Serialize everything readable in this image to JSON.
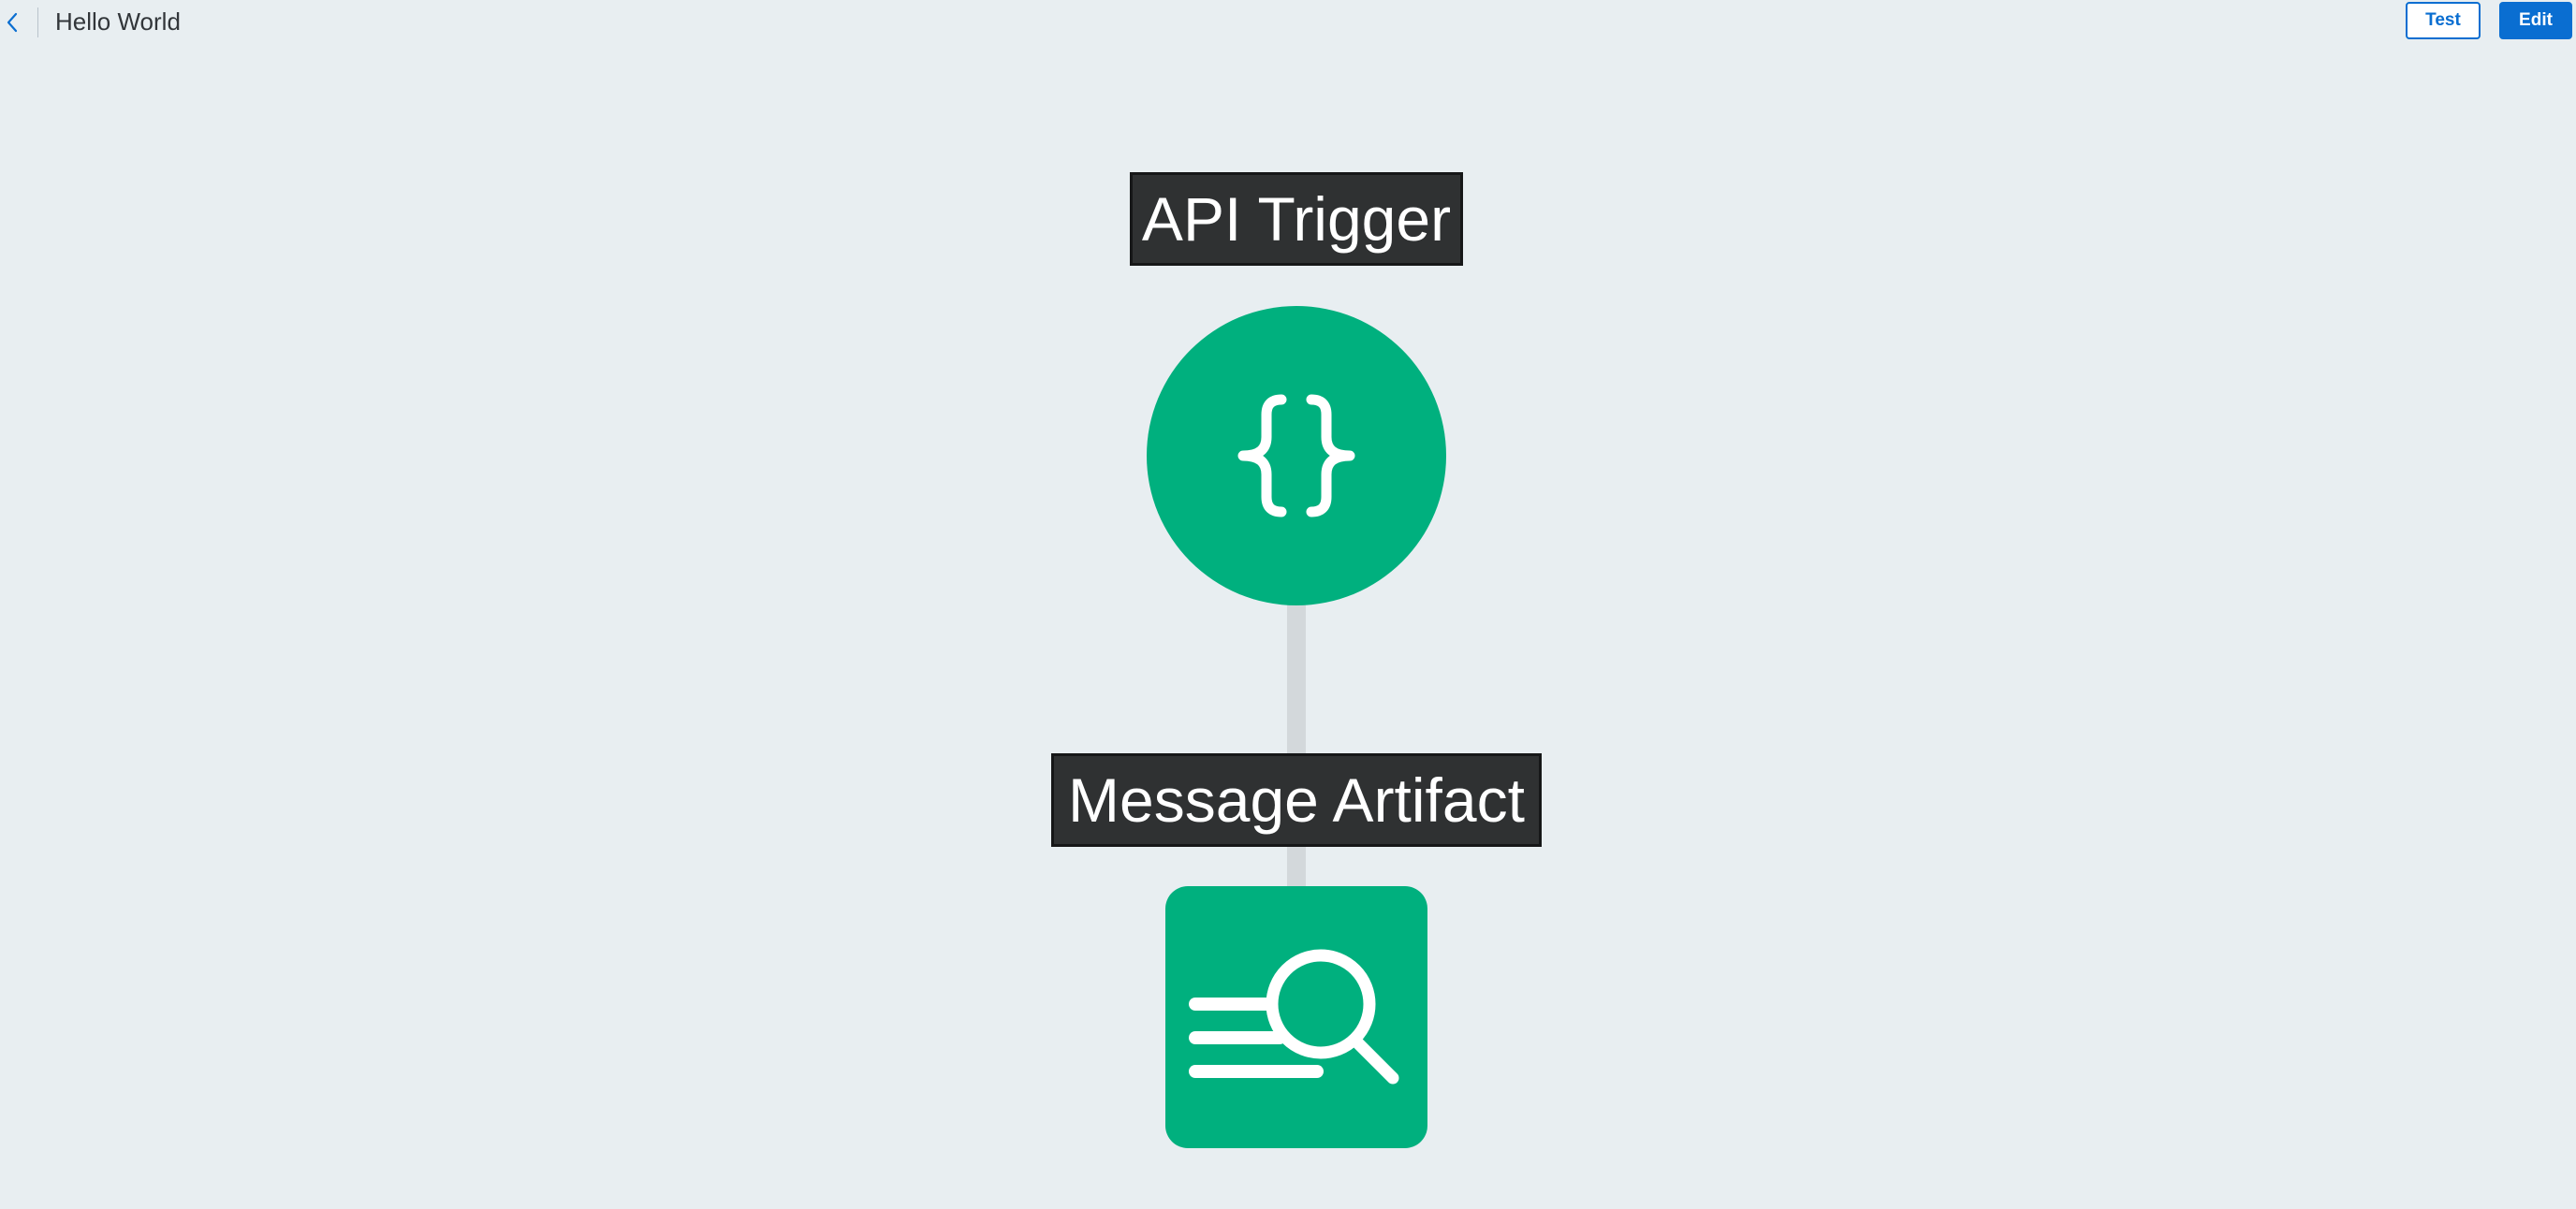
{
  "header": {
    "back_icon": "chevron-left-icon",
    "title": "Hello World",
    "test_label": "Test",
    "edit_label": "Edit"
  },
  "flow": {
    "nodes": [
      {
        "label": "API Trigger",
        "icon": "curly-braces-icon",
        "shape": "circle"
      },
      {
        "label": "Message Artifact",
        "icon": "text-search-icon",
        "shape": "rounded-square"
      }
    ]
  },
  "colors": {
    "background": "#e8eef1",
    "node": "#00b07e",
    "label_bg": "#2f3132",
    "accent": "#0a6ed1",
    "connector": "#d3d8db"
  }
}
